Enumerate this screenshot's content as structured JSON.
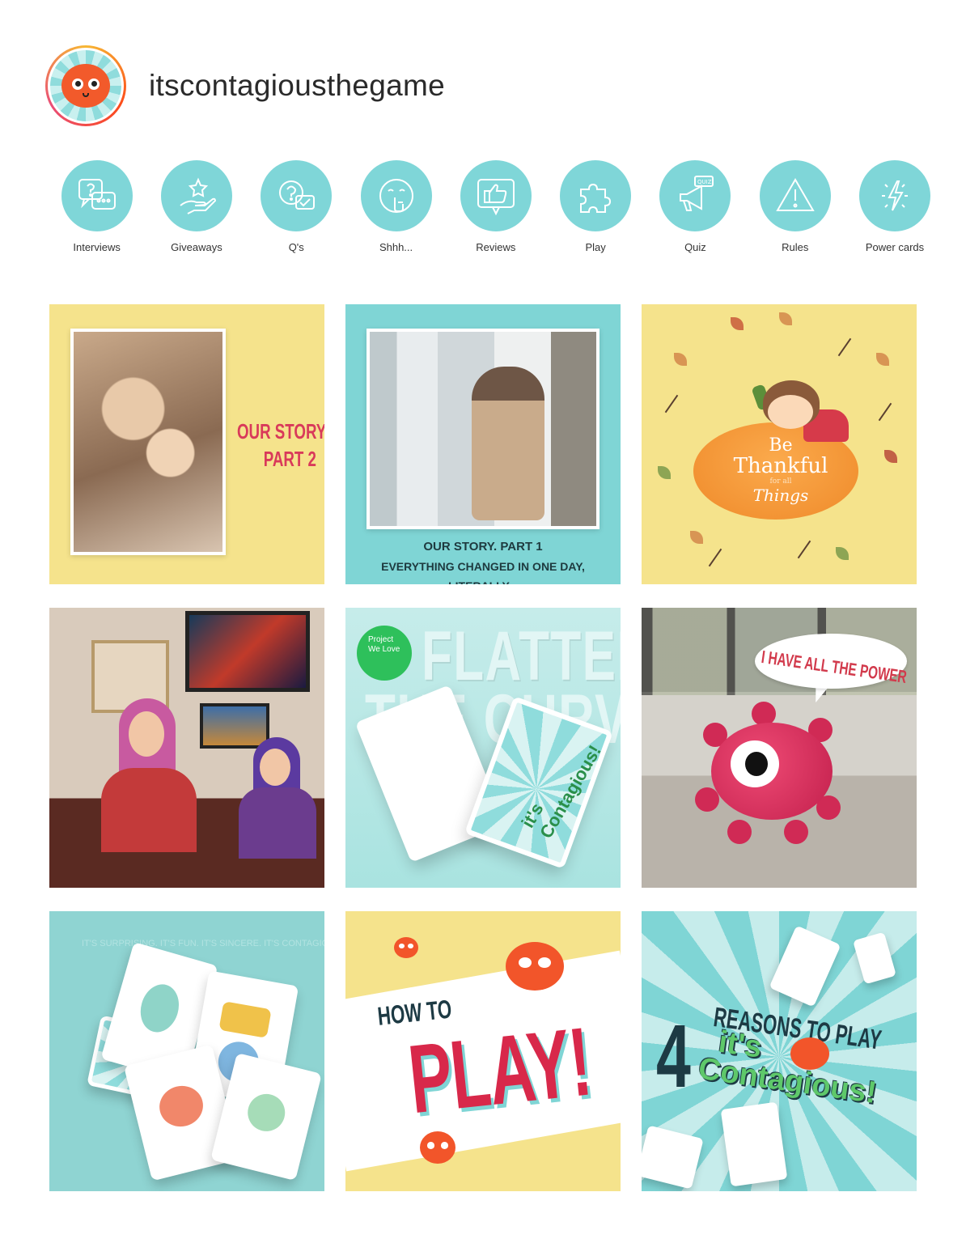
{
  "profile": {
    "username": "itscontagiousthegame"
  },
  "highlights": [
    {
      "label": "Interviews",
      "icon": "chat-question-icon"
    },
    {
      "label": "Giveaways",
      "icon": "hand-star-icon"
    },
    {
      "label": "Q's",
      "icon": "question-check-icon"
    },
    {
      "label": "Shhh...",
      "icon": "shush-face-icon"
    },
    {
      "label": "Reviews",
      "icon": "thumbs-up-icon"
    },
    {
      "label": "Play",
      "icon": "puzzle-icon"
    },
    {
      "label": "Quiz",
      "icon": "megaphone-quiz-icon"
    },
    {
      "label": "Rules",
      "icon": "warning-icon"
    },
    {
      "label": "Power cards",
      "icon": "lightning-icon"
    }
  ],
  "posts": {
    "p1": {
      "line1": "OUR STORY.",
      "line2": "PART 2"
    },
    "p2": {
      "line1": "OUR STORY. PART 1",
      "line2": "EVERYTHING CHANGED IN ONE DAY, LITERALLY..."
    },
    "p3": {
      "be": "Be",
      "thankful": "Thankful",
      "for_all": "for all",
      "things": "Things"
    },
    "p5": {
      "badge_line1": "Project",
      "badge_line2": "We Love",
      "big_line1": "FLATTEN",
      "big_line2": "THE CURVE",
      "logo": "it's Contagious!"
    },
    "p6": {
      "bubble": "I HAVE ALL THE POWER"
    },
    "p7": {
      "bg_text": "IT'S SURPRISING. IT'S FUN. IT'S SINCERE. IT'S CONTAGIOUS!™"
    },
    "p8": {
      "howto": "HOW TO",
      "play": "PLAY!"
    },
    "p9": {
      "four": "4",
      "reasons": "REASONS TO PLAY",
      "its": "it's",
      "contagious": "Contagious!"
    }
  },
  "colors": {
    "teal": "#7fd6d8",
    "yellow": "#f5e38c",
    "brand_red": "#d8284a",
    "dark_navy": "#1d3a44",
    "virus_orange": "#f25a2b"
  }
}
